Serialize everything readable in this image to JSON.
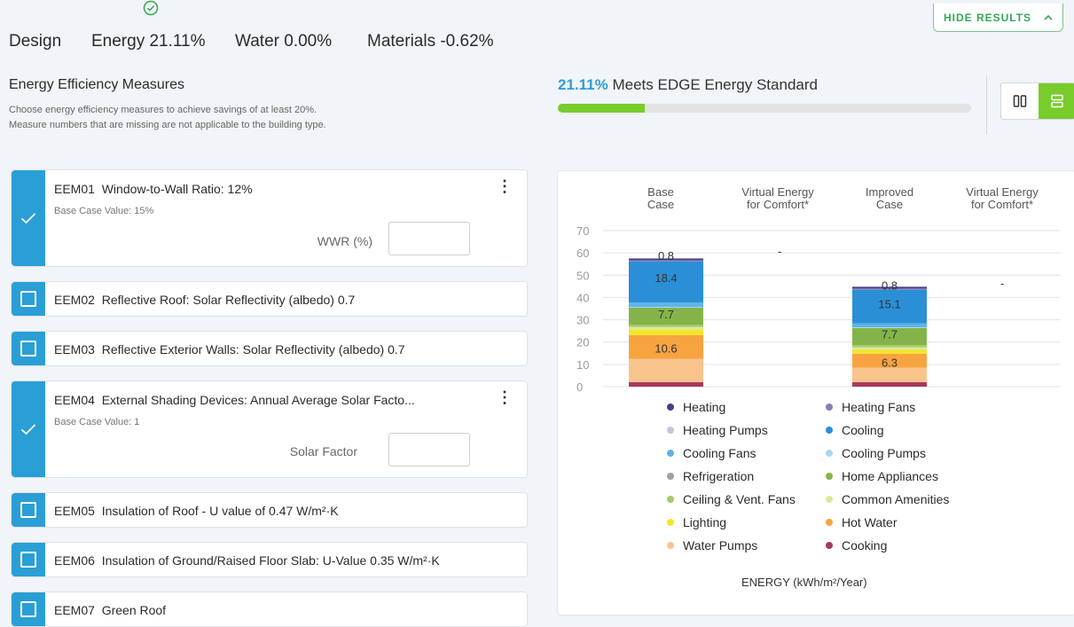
{
  "tabs": [
    {
      "label": "Design"
    },
    {
      "label": "Energy 21.11%"
    },
    {
      "label": "Water 0.00%"
    },
    {
      "label": "Materials -0.62%"
    }
  ],
  "hide_results": {
    "label": "HIDE RESULTS"
  },
  "section": {
    "title": "Energy Efficiency Measures",
    "desc_line1": "Choose energy efficiency measures to achieve savings of at least 20%.",
    "desc_line2": "Measure numbers that are missing are not applicable to the building type."
  },
  "score": {
    "value": "21.11%",
    "text": "Meets EDGE Energy Standard",
    "progress_fraction": 0.2111,
    "bar_color": "#78cc2b",
    "accent": "#2a9fd6"
  },
  "measures": [
    {
      "code": "EEM01",
      "title": "Window-to-Wall Ratio: 12%",
      "checked": true,
      "base": "Base Case Value: 15%",
      "input_label": "WWR (%)",
      "input_value": ""
    },
    {
      "code": "EEM02",
      "title": "Reflective Roof: Solar Reflectivity (albedo) 0.7",
      "checked": false
    },
    {
      "code": "EEM03",
      "title": "Reflective Exterior Walls: Solar Reflectivity (albedo) 0.7",
      "checked": false
    },
    {
      "code": "EEM04",
      "title": "External Shading Devices: Annual Average Solar Facto...",
      "checked": true,
      "base": "Base Case Value: 1",
      "input_label": "Solar Factor",
      "input_value": ""
    },
    {
      "code": "EEM05",
      "title": "Insulation of Roof - U value of 0.47 W/m²·K",
      "checked": false
    },
    {
      "code": "EEM06",
      "title": "Insulation of Ground/Raised Floor Slab: U-Value 0.35 W/m²·K",
      "checked": false
    },
    {
      "code": "EEM07",
      "title": "Green Roof",
      "checked": false
    }
  ],
  "chart_data": {
    "type": "bar",
    "stacked": true,
    "columns": [
      "Base Case",
      "Virtual Energy for Comfort*",
      "Improved Case",
      "Virtual Energy for Comfort*"
    ],
    "column_heads": [
      {
        "line1": "Base",
        "line2": "Case"
      },
      {
        "line1": "Virtual Energy",
        "line2": "for Comfort*"
      },
      {
        "line1": "Improved",
        "line2": "Case"
      },
      {
        "line1": "Virtual Energy",
        "line2": "for Comfort*"
      }
    ],
    "virtual_labels": [
      "-",
      "-"
    ],
    "ylim": [
      0,
      70
    ],
    "yticks": [
      0,
      10,
      20,
      30,
      40,
      50,
      60,
      70
    ],
    "xlabel": "ENERGY (kWh/m²/Year)",
    "series": [
      {
        "name": "Cooking",
        "color": "#a8385e",
        "values": [
          2.0,
          2.0
        ]
      },
      {
        "name": "Water Pumps",
        "color": "#f9c48c",
        "values": [
          10.5,
          6.5
        ]
      },
      {
        "name": "Hot Water",
        "color": "#f7a440",
        "values": [
          10.6,
          6.3
        ]
      },
      {
        "name": "Lighting",
        "color": "#f4e52a",
        "values": [
          2.5,
          1.7
        ]
      },
      {
        "name": "Common Amenities",
        "color": "#d8ec9a",
        "values": [
          1.2,
          1.2
        ]
      },
      {
        "name": "Ceiling & Vent. Fans",
        "color": "#a6c96a",
        "values": [
          0.9,
          0.9
        ]
      },
      {
        "name": "Home Appliances",
        "color": "#84b449",
        "values": [
          7.7,
          7.7
        ]
      },
      {
        "name": "Refrigeration",
        "color": "#a0a0a0",
        "values": [
          0.0,
          0.0
        ]
      },
      {
        "name": "Cooling Pumps",
        "color": "#a9d8f1",
        "values": [
          0.4,
          0.3
        ]
      },
      {
        "name": "Cooling Fans",
        "color": "#5fb4e6",
        "values": [
          2.0,
          1.8
        ]
      },
      {
        "name": "Cooling",
        "color": "#2a8fd6",
        "values": [
          18.4,
          15.1
        ]
      },
      {
        "name": "Heating Pumps",
        "color": "#c7c2de",
        "values": [
          0.0,
          0.0
        ]
      },
      {
        "name": "Heating Fans",
        "color": "#8a7cb8",
        "values": [
          0.5,
          0.5
        ]
      },
      {
        "name": "Heating",
        "color": "#4a3d8a",
        "values": [
          0.8,
          0.8
        ]
      }
    ],
    "data_labels": [
      {
        "column": 0,
        "text": "0.8",
        "y": 58.8
      },
      {
        "column": 0,
        "text": "18.4",
        "y": 49.0
      },
      {
        "column": 0,
        "text": "7.7",
        "y": 32.6
      },
      {
        "column": 0,
        "text": "10.6",
        "y": 17.4
      },
      {
        "column": 2,
        "text": "0.8",
        "y": 45.6
      },
      {
        "column": 2,
        "text": "15.1",
        "y": 37.2
      },
      {
        "column": 2,
        "text": "7.7",
        "y": 23.6
      },
      {
        "column": 2,
        "text": "6.3",
        "y": 11.0
      }
    ],
    "legend": [
      {
        "name": "Heating",
        "color": "#4a3d8a"
      },
      {
        "name": "Heating Fans",
        "color": "#8a7cb8"
      },
      {
        "name": "Heating Pumps",
        "color": "#c7c2de"
      },
      {
        "name": "Cooling",
        "color": "#2a8fd6"
      },
      {
        "name": "Cooling Fans",
        "color": "#5fb4e6"
      },
      {
        "name": "Cooling Pumps",
        "color": "#a9d8f1"
      },
      {
        "name": "Refrigeration",
        "color": "#a0a0a0"
      },
      {
        "name": "Home Appliances",
        "color": "#84b449"
      },
      {
        "name": "Ceiling & Vent. Fans",
        "color": "#a6c96a"
      },
      {
        "name": "Common Amenities",
        "color": "#d8ec9a"
      },
      {
        "name": "Lighting",
        "color": "#f4e52a"
      },
      {
        "name": "Hot Water",
        "color": "#f7a440"
      },
      {
        "name": "Water Pumps",
        "color": "#f9c48c"
      },
      {
        "name": "Cooking",
        "color": "#a8385e"
      }
    ]
  }
}
